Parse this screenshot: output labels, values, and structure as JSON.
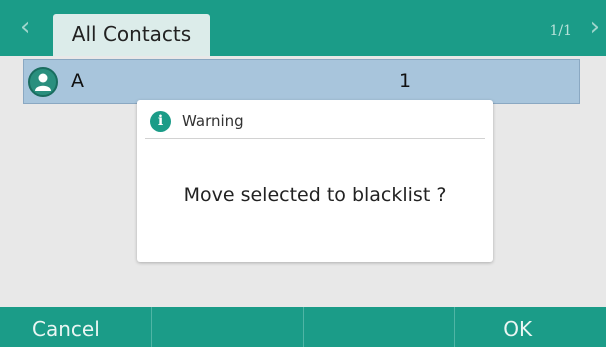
{
  "header": {
    "tab_label": "All Contacts",
    "page_indicator": "1/1",
    "prev_icon": "chevron-left-icon",
    "next_icon": "chevron-right-icon"
  },
  "contacts": [
    {
      "name": "A",
      "number": "1",
      "icon": "person-icon"
    }
  ],
  "dialog": {
    "title": "Warning",
    "icon": "info-icon",
    "icon_glyph": "i",
    "message": "Move selected to blacklist ?"
  },
  "softkeys": [
    {
      "label": "Cancel"
    },
    {
      "label": ""
    },
    {
      "label": ""
    },
    {
      "label": "OK"
    }
  ],
  "colors": {
    "accent": "#1b9c88",
    "selected_row": "#a8c5dc",
    "background": "#e8e8e8"
  }
}
